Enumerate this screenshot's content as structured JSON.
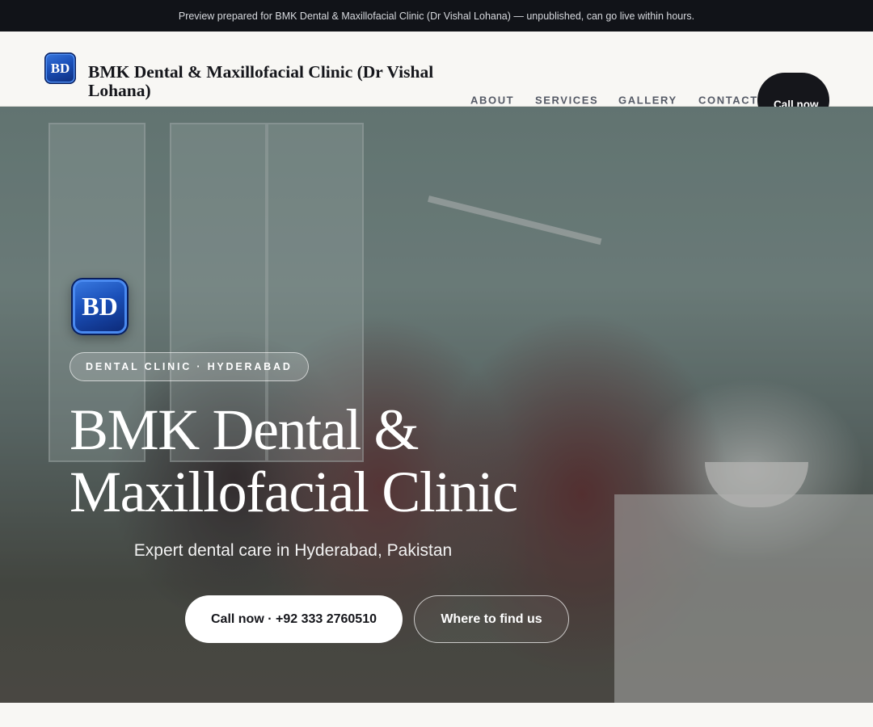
{
  "preview_banner": {
    "text": "Preview prepared for BMK Dental & Maxillofacial Clinic (Dr Vishal Lohana) — unpublished, can go live within hours."
  },
  "header": {
    "logo_initials": "BD",
    "brand_name": "BMK Dental & Maxillofacial Clinic (Dr Vishal Lohana)",
    "nav": [
      {
        "label": "ABOUT"
      },
      {
        "label": "SERVICES"
      },
      {
        "label": "GALLERY"
      },
      {
        "label": "CONTACT"
      }
    ],
    "call_button": "Call now"
  },
  "hero": {
    "logo_initials": "BD",
    "badge": "DENTAL CLINIC · HYDERABAD",
    "title": "BMK Dental & Maxillofacial Clinic",
    "subtitle": "Expert dental care in Hyderabad, Pakistan",
    "primary_button": "Call now · +92 333 2760510",
    "secondary_button": "Where to find us",
    "background_icon": "dental-clinic-photo"
  },
  "colors": {
    "dark": "#111318",
    "accent_blue": "#1a4fb8",
    "page_bg": "#f8f7f4",
    "nav_text": "#555a66"
  }
}
